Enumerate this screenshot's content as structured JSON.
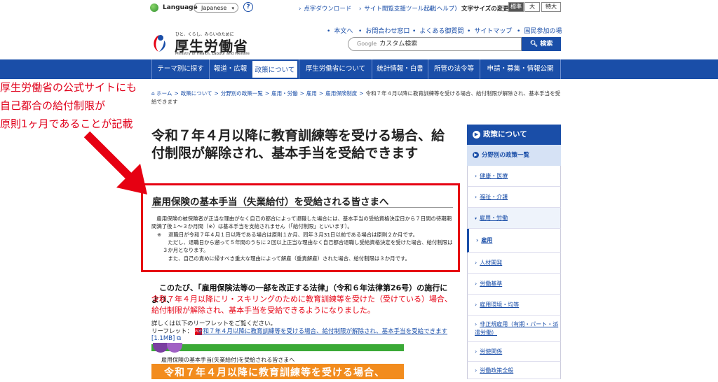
{
  "util": {
    "language_label": "Language",
    "language_value": "Japanese",
    "help": "?",
    "links": [
      "点字ダウンロード",
      "サイト閲覧支援ツール起動",
      "(ヘルプ)"
    ],
    "font_size_label": "文字サイズの変更",
    "font_sizes": [
      "標準",
      "大",
      "特大"
    ]
  },
  "header": {
    "tagline": "ひと、くらし、みらいのために",
    "logo": "厚生労働省",
    "logo_en": "Ministry of Health, Labour and Welfare",
    "links": [
      "本文へ",
      "お問合わせ窓口",
      "よくある御質問",
      "サイトマップ",
      "国民参加の場"
    ],
    "search_google": "Google",
    "search_placeholder": "カスタム検索",
    "search_button": "検索"
  },
  "nav": [
    "テーマ別に探す",
    "報道・広報",
    "政策について",
    "厚生労働省について",
    "統計情報・白書",
    "所管の法令等",
    "申請・募集・情報公開"
  ],
  "breadcrumb": {
    "items": [
      "ホーム",
      "政策について",
      "分野別の政策一覧",
      "雇用・労働",
      "雇用",
      "雇用保険制度"
    ],
    "current": "令和７年４月以降に教育訓練等を受ける場合、給付制限が解除され、基本手当を受給できます"
  },
  "annotation": [
    "厚生労働省の公式サイトにも",
    "自己都合の給付制限が",
    "原則1ヶ月であることが記載"
  ],
  "main": {
    "title": "令和７年４月以降に教育訓練等を受ける場合、給付制限が解除され、基本手当を受給できます",
    "section_title": "雇用保険の基本手当（失業給付）を受給される皆さまへ",
    "para1": "雇用保険の被保険者が正当な理由がなく自己の都合によって退職した場合には、基本手当の受給資格決定日から７日間の待期期間満了後１～３か月間（※）は基本手当を支給されません（「給付制限」といいます）。",
    "note_mark": "※",
    "note1": "退職日が令和７年４月１日以降である場合は原則１か月、同年３月31日以前である場合は原則２か月です。",
    "note2": "ただし、退職日から遡って５年間のうちに２回以上正当な理由なく自己都合退職し受給資格決定を受けた場合、給付制限は３か月となります。",
    "note3": "また、自己の責めに帰すべき重大な理由によって解雇（重責解雇）された場合、給付制限は３か月です。",
    "lead": "このたび、「雇用保険法等の一部を改正する法律」（令和６年法律第26号）の施行により、",
    "lead_red": "令和７年４月以降にリ・スキリングのために教育訓練等を受けた（受けている）場合、給付制限が解除され、基本手当を受給できるようになりました。",
    "detail": "詳しくは以下のリーフレットをご覧ください。",
    "leaflet_label": "リーフレット：",
    "pdf": "PDF",
    "leaflet_link": "令和７年４月以降に教育訓練等を受ける場合、給付制限が解除され、基本手当を受給できます",
    "leaflet_size": "[1.1MB]",
    "flyer_sub": "雇用保険の基本手当(失業給付)を受給される皆さまへ",
    "flyer_title": "令和７年４月以降に教育訓練等を受ける場合、"
  },
  "side": {
    "head": "政策について",
    "sub": "分野別の政策一覧",
    "items": [
      "健康・医療",
      "福祉・介護",
      "雇用・労働",
      "雇用",
      "人材開発",
      "労働基準",
      "雇用環境・均等",
      "非正規雇用（有期・パート・派遣労働）",
      "労使関係",
      "労働政策全般"
    ]
  },
  "colors": {
    "brand": "#1a4ea8",
    "highlight": "#e60012",
    "annotation": "#e0001b"
  }
}
